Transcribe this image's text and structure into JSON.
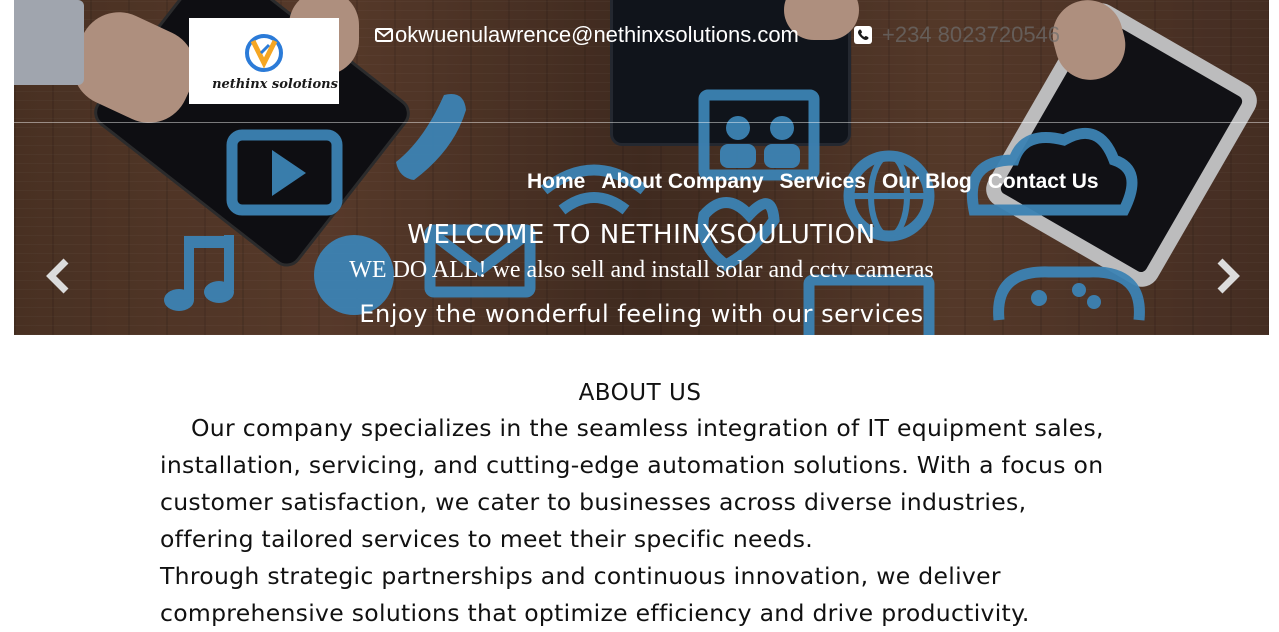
{
  "header": {
    "logo_text": "nethinx solotions",
    "email": "okwuenulawrence@nethinxsolutions.com",
    "phone": "+234 8023720546",
    "email_icon": "envelope-icon",
    "phone_icon": "phone-square-icon"
  },
  "nav": {
    "items": [
      "Home",
      "About Company",
      "Services",
      "Our Blog",
      "Contact Us"
    ]
  },
  "hero": {
    "title": "WELCOME TO NETHINXSOULUTION",
    "subtitle": "WE DO ALL! we also sell and install solar and cctv cameras",
    "tagline": "Enjoy the wonderful feeling with our services",
    "prev_icon": "chevron-left-icon",
    "next_icon": "chevron-right-icon"
  },
  "about": {
    "title": "ABOUT US",
    "paragraph1": "Our company specializes in the seamless integration of IT equipment sales, installation, servicing, and cutting-edge automation solutions. With a focus on customer satisfaction, we cater to businesses across diverse industries, offering tailored services to meet their specific needs.",
    "paragraph2": "Through strategic partnerships and continuous innovation, we deliver comprehensive solutions that optimize efficiency and drive productivity."
  },
  "colors": {
    "icon_blue": "#4aa8e8",
    "logo_blue": "#2b7bd8",
    "logo_orange": "#f5a623"
  }
}
